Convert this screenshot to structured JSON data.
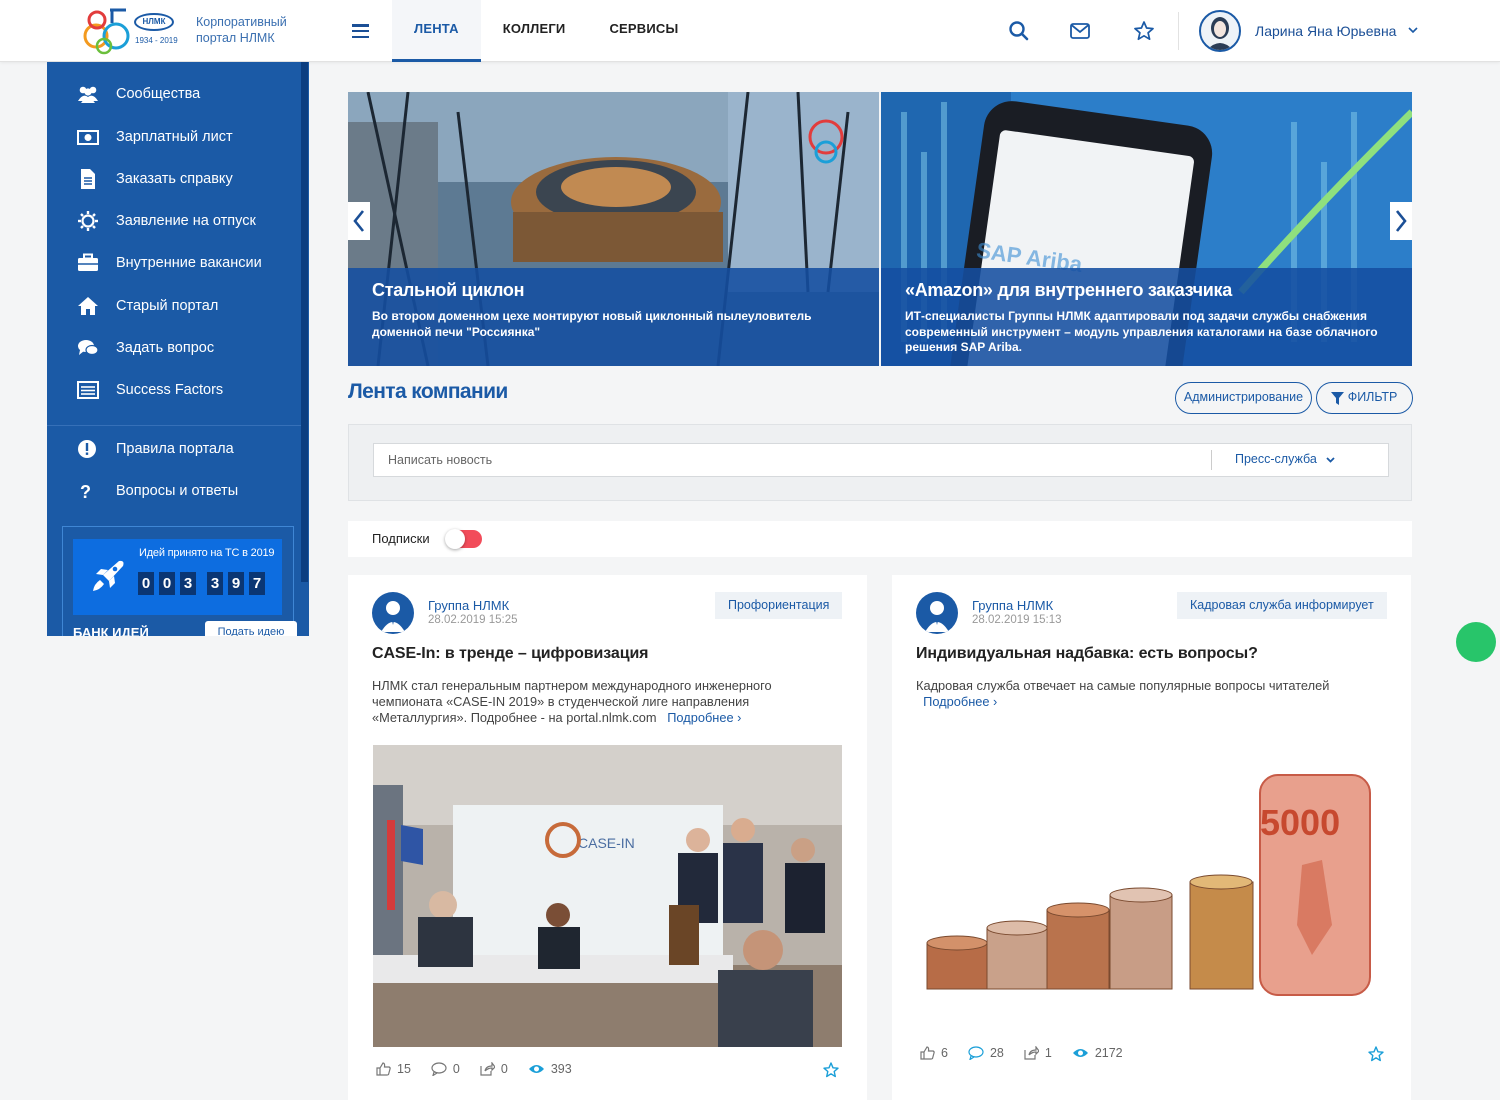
{
  "header": {
    "logo_text": "НЛМК",
    "logo_years": "1934 - 2019",
    "portal_title": "Корпоративный портал НЛМК",
    "nav": [
      {
        "label": "ЛЕНТА",
        "active": true
      },
      {
        "label": "КОЛЛЕГИ",
        "active": false
      },
      {
        "label": "СЕРВИСЫ",
        "active": false
      }
    ],
    "user_name": "Ларина Яна Юрьевна",
    "icons": [
      "menu-icon",
      "search-icon",
      "mail-icon",
      "star-icon",
      "chevron-down-icon"
    ]
  },
  "sidebar": {
    "items": [
      {
        "label": "Сообщества",
        "icon": "users-icon"
      },
      {
        "label": "Зарплатный лист",
        "icon": "money-icon"
      },
      {
        "label": "Заказать справку",
        "icon": "document-icon"
      },
      {
        "label": "Заявление на отпуск",
        "icon": "sun-icon"
      },
      {
        "label": "Внутренние вакансии",
        "icon": "briefcase-icon"
      },
      {
        "label": "Старый портал",
        "icon": "home-icon"
      },
      {
        "label": "Задать вопрос",
        "icon": "chat-icon"
      },
      {
        "label": "Success Factors",
        "icon": "list-icon"
      }
    ],
    "items2": [
      {
        "label": "Правила портала",
        "icon": "exclamation-icon"
      },
      {
        "label": "Вопросы и ответы",
        "icon": "question-icon"
      }
    ],
    "idea": {
      "title": "Идей принято на ТС в 2019",
      "digits": [
        "0",
        "0",
        "3",
        "3",
        "9",
        "7"
      ],
      "bank": "БАНК ИДЕЙ",
      "submit": "Подать идею"
    }
  },
  "slider": {
    "slides": [
      {
        "title": "Стальной циклон",
        "text": "Во втором доменном цехе монтируют новый циклонный пылеуловитель доменной печи \"Россиянка\""
      },
      {
        "title": "«Amazon» для внутреннего заказчика",
        "text": "ИТ-специалисты Группы НЛМК адаптировали под задачи службы снабжения современный инструмент – модуль управления каталогами на базе облачного решения SAP Ariba."
      }
    ]
  },
  "feed": {
    "title": "Лента компании",
    "admin_button": "Администрирование",
    "filter_button": "ФИЛЬТР",
    "composer_placeholder": "Написать новость",
    "composer_source": "Пресс-служба",
    "subscriptions_label": "Подписки",
    "subscriptions_on": true
  },
  "posts": [
    {
      "author": "Группа НЛМК",
      "date": "28.02.2019 15:25",
      "tag": "Профориентация",
      "title": "CASE-In: в тренде – цифровизация",
      "text": "НЛМК стал генеральным партнером международного инженерного чемпионата «CASE-IN 2019» в студенческой лиге направления «Металлургия». Подробнее - на portal.nlmk.com",
      "more": "Подробнее ›",
      "likes": "15",
      "comments": "0",
      "shares": "0",
      "views": "393"
    },
    {
      "author": "Группа НЛМК",
      "date": "28.02.2019 15:13",
      "tag": "Кадровая служба информирует",
      "title": "Индивидуальная надбавка: есть вопросы?",
      "text": "Кадровая служба отвечает на самые популярные вопросы читателей",
      "more": "Подробнее ›",
      "likes": "6",
      "comments": "28",
      "shares": "1",
      "views": "2172"
    }
  ],
  "colors": {
    "brand_blue": "#1b5aa6",
    "sidebar_blue": "#1b5aa6",
    "toggle_red": "#f24c5a",
    "chat_green": "#28c56a"
  }
}
